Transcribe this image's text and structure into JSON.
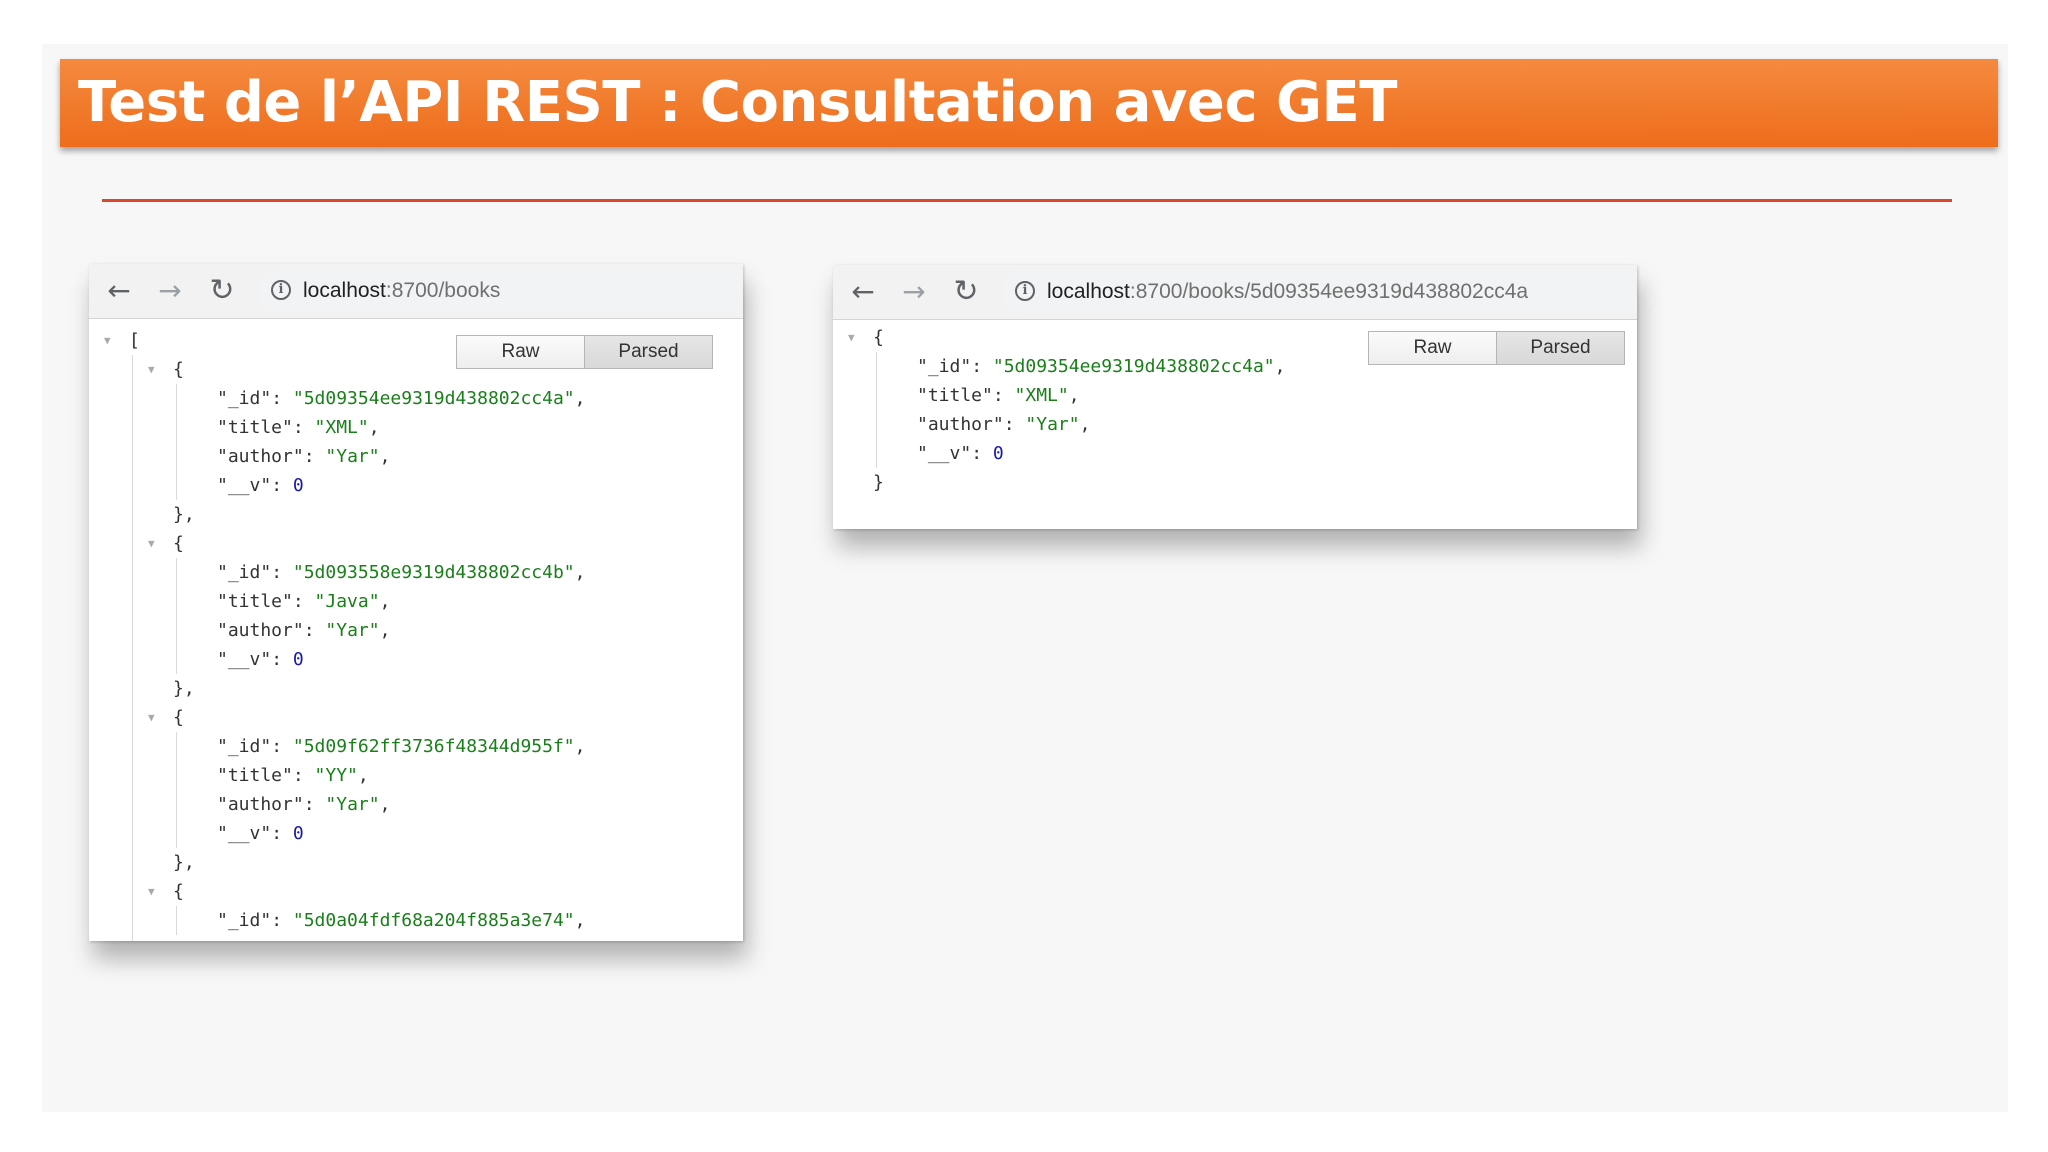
{
  "slide": {
    "title": "Test de l’API REST : Consultation avec GET"
  },
  "window_list": {
    "url_host": "localhost",
    "url_rest": ":8700/books",
    "buttons": {
      "raw": "Raw",
      "parsed": "Parsed"
    },
    "json_lines": [
      {
        "indent": 0,
        "text": "[",
        "toggle": true
      },
      {
        "indent": 1,
        "text": "{",
        "toggle": true
      },
      {
        "indent": 2,
        "key": "\"_id\"",
        "value": "\"5d09354ee9319d438802cc4a\"",
        "vtype": "s",
        "comma": true
      },
      {
        "indent": 2,
        "key": "\"title\"",
        "value": "\"XML\"",
        "vtype": "s",
        "comma": true
      },
      {
        "indent": 2,
        "key": "\"author\"",
        "value": "\"Yar\"",
        "vtype": "s",
        "comma": true
      },
      {
        "indent": 2,
        "key": "\"__v\"",
        "value": "0",
        "vtype": "n",
        "comma": false
      },
      {
        "indent": 1,
        "text": "},"
      },
      {
        "indent": 1,
        "text": "{",
        "toggle": true
      },
      {
        "indent": 2,
        "key": "\"_id\"",
        "value": "\"5d093558e9319d438802cc4b\"",
        "vtype": "s",
        "comma": true
      },
      {
        "indent": 2,
        "key": "\"title\"",
        "value": "\"Java\"",
        "vtype": "s",
        "comma": true
      },
      {
        "indent": 2,
        "key": "\"author\"",
        "value": "\"Yar\"",
        "vtype": "s",
        "comma": true
      },
      {
        "indent": 2,
        "key": "\"__v\"",
        "value": "0",
        "vtype": "n",
        "comma": false
      },
      {
        "indent": 1,
        "text": "},"
      },
      {
        "indent": 1,
        "text": "{",
        "toggle": true
      },
      {
        "indent": 2,
        "key": "\"_id\"",
        "value": "\"5d09f62ff3736f48344d955f\"",
        "vtype": "s",
        "comma": true
      },
      {
        "indent": 2,
        "key": "\"title\"",
        "value": "\"YY\"",
        "vtype": "s",
        "comma": true
      },
      {
        "indent": 2,
        "key": "\"author\"",
        "value": "\"Yar\"",
        "vtype": "s",
        "comma": true
      },
      {
        "indent": 2,
        "key": "\"__v\"",
        "value": "0",
        "vtype": "n",
        "comma": false
      },
      {
        "indent": 1,
        "text": "},"
      },
      {
        "indent": 1,
        "text": "{",
        "toggle": true
      },
      {
        "indent": 2,
        "key": "\"_id\"",
        "value": "\"5d0a04fdf68a204f885a3e74\"",
        "vtype": "s",
        "comma": true
      }
    ]
  },
  "window_single": {
    "url_host": "localhost",
    "url_rest": ":8700/books/5d09354ee9319d438802cc4a",
    "buttons": {
      "raw": "Raw",
      "parsed": "Parsed"
    },
    "json_lines": [
      {
        "indent": 0,
        "text": "{",
        "toggle": true
      },
      {
        "indent": 1,
        "key": "\"_id\"",
        "value": "\"5d09354ee9319d438802cc4a\"",
        "vtype": "s",
        "comma": true
      },
      {
        "indent": 1,
        "key": "\"title\"",
        "value": "\"XML\"",
        "vtype": "s",
        "comma": true
      },
      {
        "indent": 1,
        "key": "\"author\"",
        "value": "\"Yar\"",
        "vtype": "s",
        "comma": true
      },
      {
        "indent": 1,
        "key": "\"__v\"",
        "value": "0",
        "vtype": "n",
        "comma": false
      },
      {
        "indent": 0,
        "text": "}"
      }
    ]
  },
  "colors": {
    "title_bar": "#ee6d1c",
    "divider": "#d9482a",
    "json_string": "#1a7f1a",
    "json_number": "#1a1aa6"
  }
}
